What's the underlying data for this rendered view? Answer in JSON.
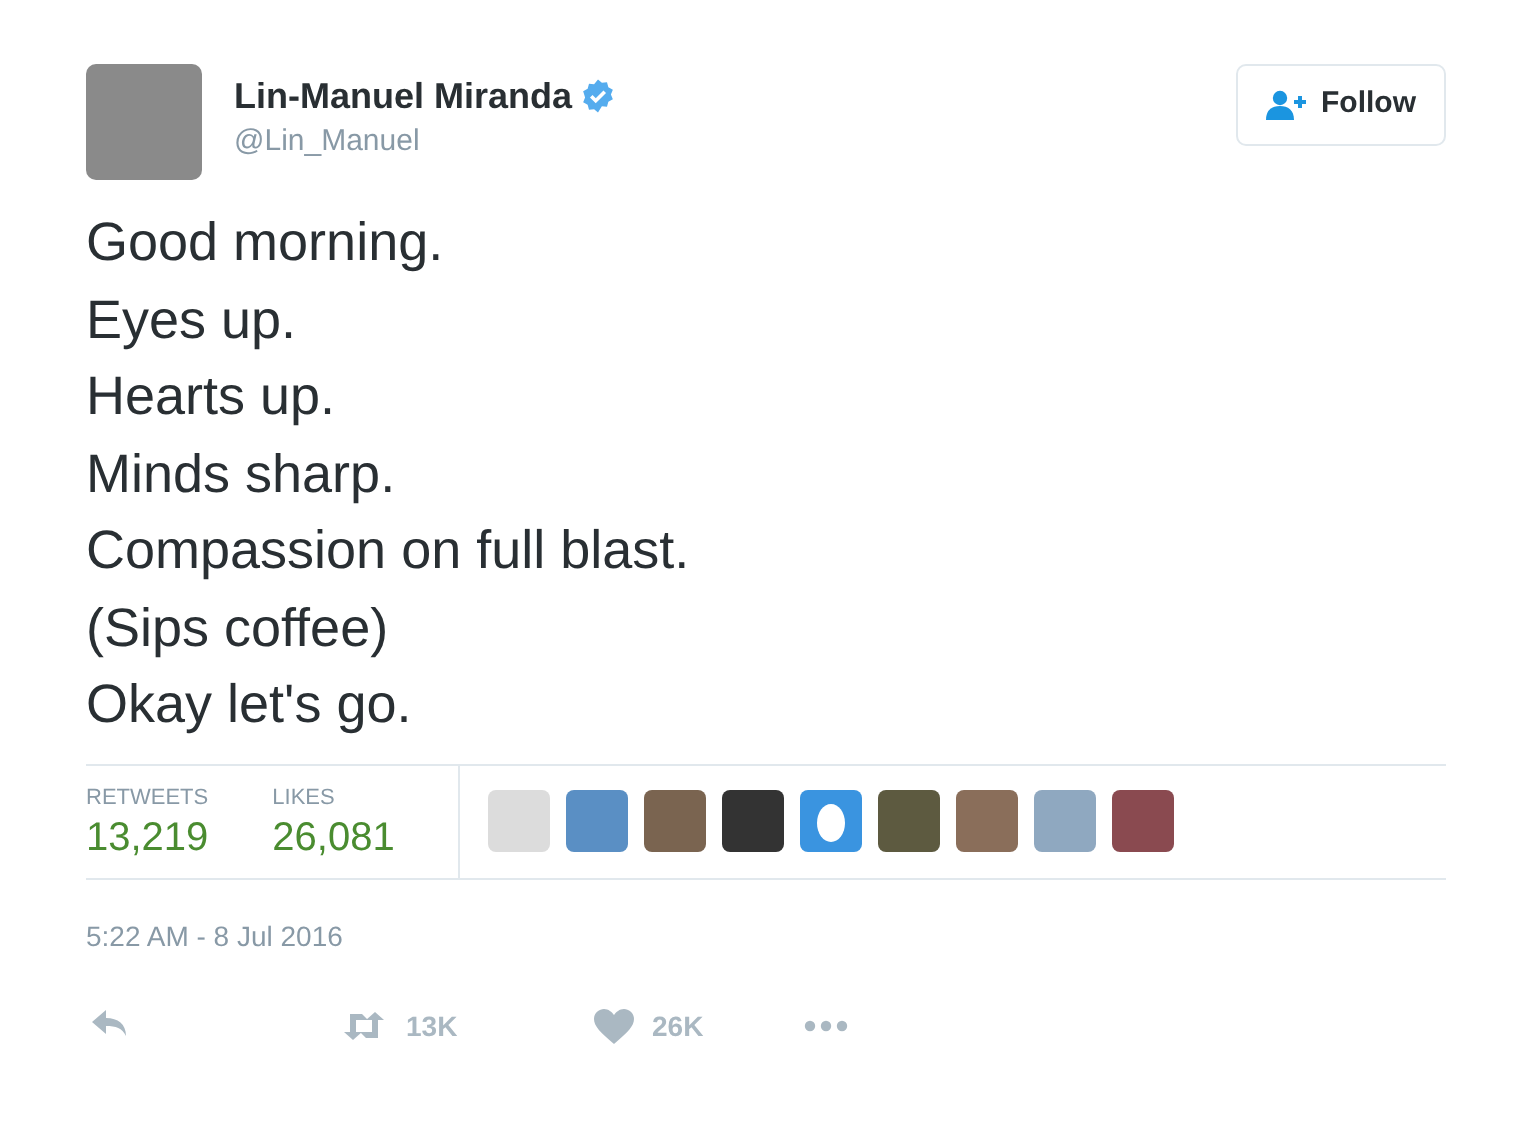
{
  "author": {
    "name": "Lin-Manuel Miranda",
    "verified": true,
    "handle": "@Lin_Manuel"
  },
  "follow_button": {
    "label": "Follow"
  },
  "tweet_lines": [
    "Good morning.",
    "Eyes up.",
    "Hearts up.",
    "Minds sharp.",
    "Compassion on full blast.",
    "(Sips coffee)",
    "Okay let's go."
  ],
  "stats": [
    {
      "label": "RETWEETS",
      "value": "13,219"
    },
    {
      "label": "LIKES",
      "value": "26,081"
    }
  ],
  "likers": [
    {
      "kind": "photo"
    },
    {
      "kind": "photo"
    },
    {
      "kind": "photo"
    },
    {
      "kind": "photo"
    },
    {
      "kind": "egg"
    },
    {
      "kind": "photo"
    },
    {
      "kind": "photo"
    },
    {
      "kind": "photo"
    },
    {
      "kind": "photo"
    }
  ],
  "timestamp": "5:22 AM - 8 Jul 2016",
  "actions": [
    {
      "kind": "reply"
    },
    {
      "kind": "retweet",
      "count": "13K"
    },
    {
      "kind": "like",
      "count": "26K"
    },
    {
      "kind": "more"
    }
  ]
}
